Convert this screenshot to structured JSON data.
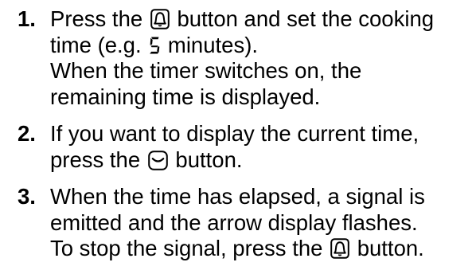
{
  "instructions": {
    "steps": [
      {
        "number": "1.",
        "line1_before_icon": "Press the",
        "line1_icon": "bell-icon",
        "line1_after_icon": "button and set the cooking",
        "line2_before_digit": "time (e.g.",
        "line2_digit": "5",
        "line2_after_digit": "minutes).",
        "line3": "When the timer switches on, the",
        "line4": "remaining time is displayed."
      },
      {
        "number": "2.",
        "line1": "If you want to display the current time,",
        "line2_before_icon": "press the",
        "line2_icon": "clock-display-icon",
        "line2_after_icon": "button."
      },
      {
        "number": "3.",
        "line1": "When the time has elapsed, a signal is",
        "line2": "emitted and the arrow display flashes.",
        "line3_before_icon": "To stop the signal, press the",
        "line3_icon": "bell-icon",
        "line3_after_icon": "button."
      }
    ]
  }
}
